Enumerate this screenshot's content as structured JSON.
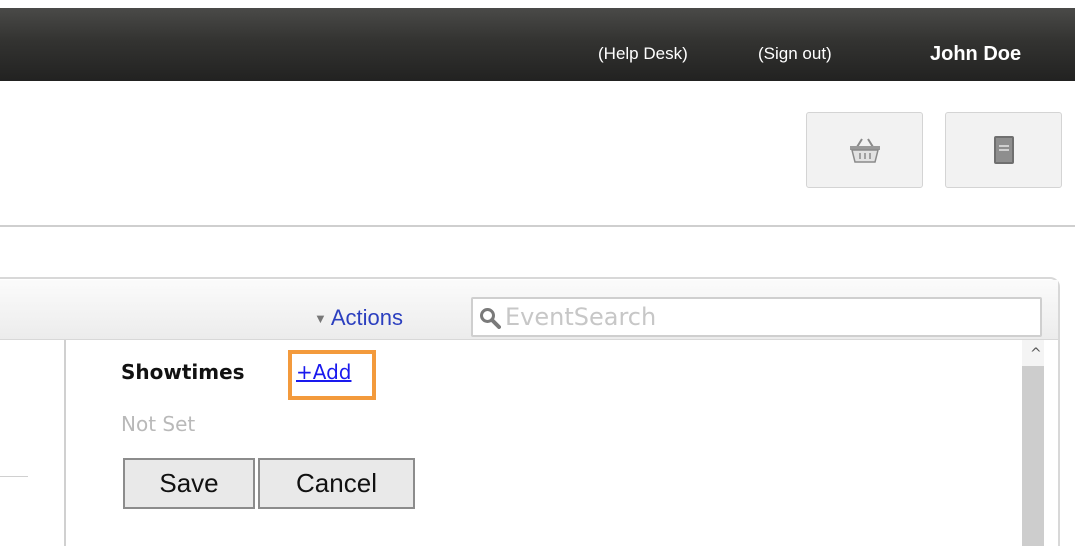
{
  "header": {
    "help_desk": "(Help Desk)",
    "sign_out": "(Sign out)",
    "user_name": "John Doe"
  },
  "icons": {
    "basket": "basket-icon",
    "book": "book-icon",
    "search": "magnifier-icon"
  },
  "toolbar": {
    "actions_caret": "▼",
    "actions_label": "Actions",
    "search_placeholder": "EventSearch"
  },
  "editor": {
    "showtimes_label": "Showtimes",
    "add_link": "+Add",
    "not_set": "Not Set",
    "save_label": "Save",
    "cancel_label": "Cancel"
  },
  "scroll": {
    "up_arrow": "^"
  },
  "colors": {
    "link_blue": "#1a1aee",
    "highlight_orange": "#f39a3c",
    "topbar_dark": "#2f2f2d"
  }
}
